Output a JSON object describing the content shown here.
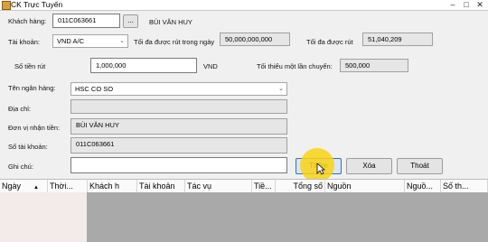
{
  "window": {
    "title": "CK Trực Tuyến",
    "minimize": "–",
    "maximize": "□",
    "close": "✕"
  },
  "form": {
    "customer_label": "Khách hàng:",
    "customer_code": "011C063661",
    "customer_browse": "...",
    "customer_name": "BÙI VĂN HUY",
    "account_label": "Tài khoản:",
    "account_value": "VND A/C",
    "max_withdraw_day_label": "Tối đa được rút trong ngày",
    "max_withdraw_day_value": "50,000,000,000",
    "max_withdraw_label": "Tối đa được rút",
    "max_withdraw_value": "51,040,209",
    "amount_label": "Số tiền rút",
    "amount_value": "1,000,000",
    "currency": "VND",
    "min_transfer_label": "Tối thiểu một lần chuyển:",
    "min_transfer_value": "500,000",
    "bank_label": "Tên ngân hàng:",
    "bank_value": "HSC CO SO",
    "address_label": "Địa chỉ:",
    "address_value": "",
    "recipient_label": "Đơn vị nhận tiền:",
    "recipient_value": "BÙI VĂN HUY",
    "account_no_label": "Số tài khoản:",
    "account_no_value": "011C063661",
    "note_label": "Ghi chú:",
    "note_value": ""
  },
  "buttons": {
    "add": "Thêm",
    "delete": "Xóa",
    "exit": "Thoát"
  },
  "grid": {
    "columns": [
      "Ngày",
      "Thời...",
      "Khách h",
      "Tài khoản",
      "Tác vụ",
      "Tiề...",
      "Tổng số",
      "Nguồn",
      "Nguồ...",
      "Số th..."
    ]
  }
}
